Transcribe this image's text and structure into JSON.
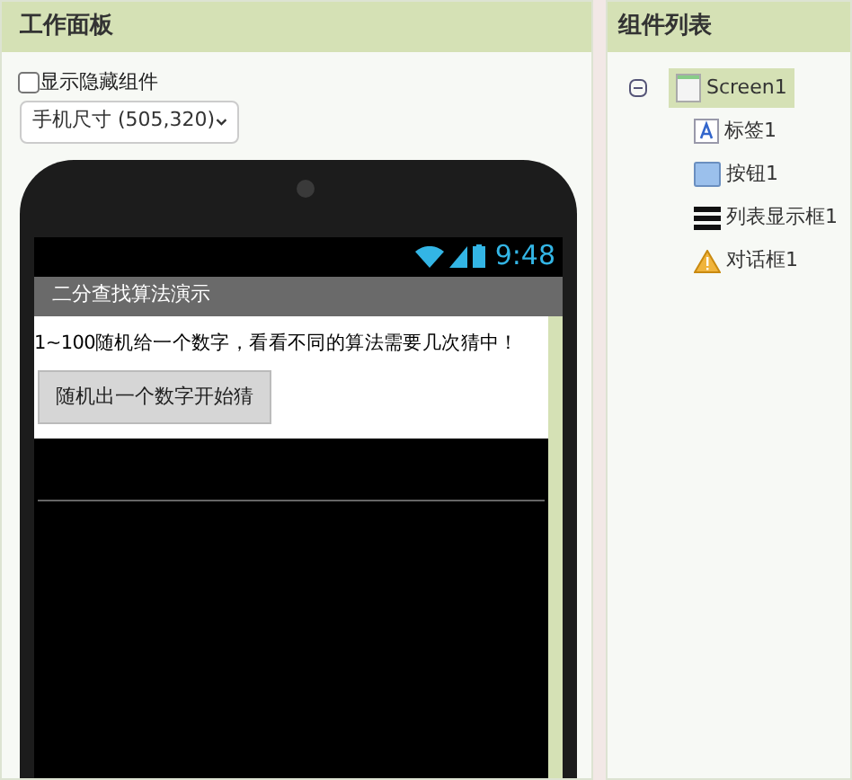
{
  "viewer": {
    "title": "工作面板",
    "show_hidden": {
      "label": "显示隐藏组件",
      "checked": false
    },
    "size_select": {
      "value": "手机尺寸 (505,320)"
    },
    "phone": {
      "time": "9:48",
      "app_title": "二分查找算法演示",
      "label": "1~100随机给一个数字，看看不同的算法需要几次猜中！",
      "button": "随机出一个数字开始猜"
    }
  },
  "components": {
    "title": "组件列表",
    "tree": [
      {
        "label": "Screen1",
        "kind": "screen",
        "expanded": true,
        "selected": true,
        "children": [
          {
            "label": "标签1",
            "kind": "label",
            "selected": false
          },
          {
            "label": "按钮1",
            "kind": "button",
            "selected": false
          },
          {
            "label": "列表显示框1",
            "kind": "listview",
            "selected": false
          },
          {
            "label": "对话框1",
            "kind": "notifier",
            "selected": false
          }
        ]
      }
    ]
  }
}
